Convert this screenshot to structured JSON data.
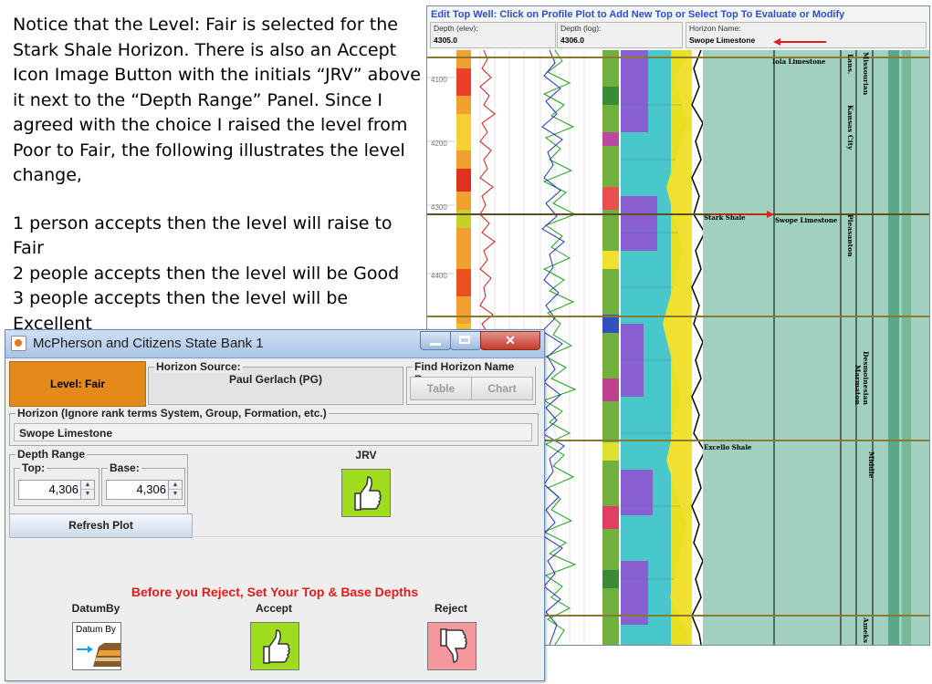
{
  "note": {
    "paragraph": [
      "Notice that the Level: Fair is selected for the",
      "Stark Shale Horizon.  There is also an Accept",
      "Icon Image Button with the initials “JRV” above",
      "it next to the “Depth Range” Panel. Since I",
      "agreed with the choice I raised the level from",
      "Poor to Fair, the following illustrates the level",
      "change,"
    ],
    "rules": [
      "1 person accepts then the level will raise to Fair",
      "2 people accepts then the level will be Good",
      "3 people accepts then the level will be Excellent"
    ]
  },
  "log_window": {
    "title": "Edit Top Well: Click on Profile Plot to Add New Top or Select Top To Evaluate or Modify",
    "depth_elev_label": "Depth (elev):",
    "depth_elev_value": "4305.0",
    "depth_log_label": "Depth (log):",
    "depth_log_value": "4306.0",
    "horizon_name_label": "Horizon Name:",
    "horizon_name_value": "Swope Limestone",
    "depth_ticks": [
      "4100",
      "4200",
      "4300",
      "4400"
    ],
    "tops": [
      "Iola Limestone",
      "Stark Shale",
      "Swope Limestone",
      "Excello Shale"
    ],
    "stratigraphy": [
      "Missourian",
      "Lans.",
      "Kansas City",
      "Pleasanton",
      "Desmoinesian",
      "Marmaton",
      "Middle",
      "Ameks"
    ]
  },
  "dialog": {
    "title": "McPherson and Citizens State Bank 1",
    "level_label": "Level: Fair",
    "level_color": "#e38a1b",
    "horizon_source": {
      "label": "Horizon Source:",
      "value": "Paul Gerlach (PG)"
    },
    "find_horizon": {
      "label": "Find Horizon Name By:",
      "table_button": "Table",
      "chart_button": "Chart"
    },
    "horizon": {
      "label": "Horizon (Ignore rank terms System, Group, Formation, etc.)",
      "value": "Swope Limestone"
    },
    "depth_range": {
      "label": "Depth Range",
      "top_label": "Top:",
      "top_value": "4,306",
      "base_label": "Base:",
      "base_value": "4,306"
    },
    "refresh_button": "Refresh Plot",
    "jrv_label": "JRV",
    "warning": "Before you Reject, Set Your Top & Base Depths",
    "datum": {
      "label": "DatumBy",
      "icon_text": "Datum By"
    },
    "accept_label": "Accept",
    "reject_label": "Reject",
    "accept_color": "#9fdc1e",
    "reject_color": "#f5979c"
  }
}
